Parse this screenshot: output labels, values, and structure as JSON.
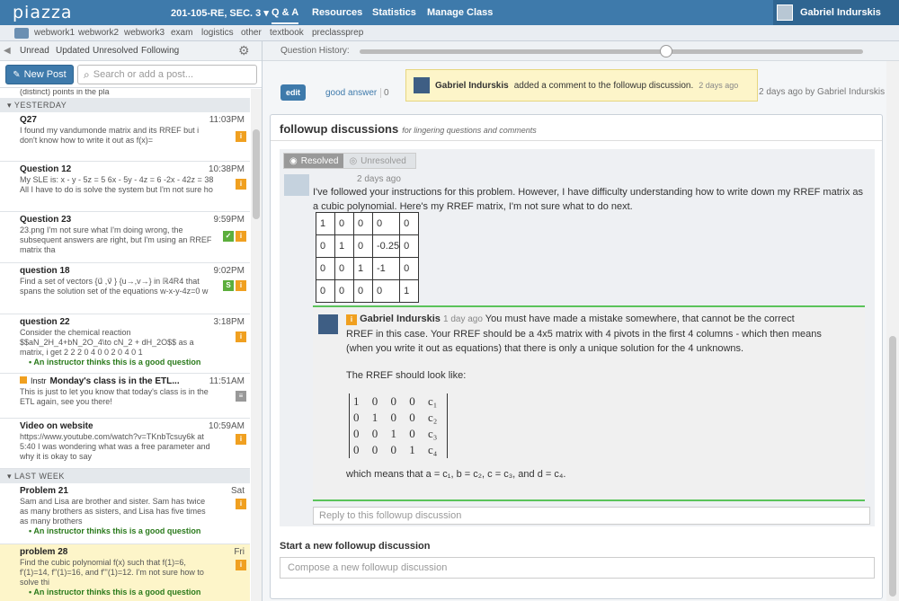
{
  "topbar": {
    "logo": "piazza",
    "course": "201-105-RE, SEC. 3",
    "course_caret": "▾",
    "nav": [
      "Q & A",
      "Resources",
      "Statistics",
      "Manage Class"
    ],
    "user_name": "Gabriel Indurskis"
  },
  "folders": [
    "webwork1",
    "webwork2",
    "webwork3",
    "exam",
    "logistics",
    "other",
    "textbook",
    "preclassprep"
  ],
  "filters": [
    "Unread",
    "Updated",
    "Unresolved",
    "Following"
  ],
  "history_label": "Question History:",
  "new_post": "New Post",
  "search_placeholder": "Search or add a post...",
  "feed": {
    "top_snippet": "(distinct) points in the pla",
    "section_yesterday": "YESTERDAY",
    "section_lastweek": "LAST WEEK",
    "good_label": "An instructor thinks this is a good question",
    "posts": [
      {
        "title": "Q27",
        "time": "11:03PM",
        "body": "I found my vandumonde matrix and its RREF but i don't know how to write it out as f(x)=",
        "badge": "i"
      },
      {
        "title": "Question 12",
        "time": "10:38PM",
        "body": "My SLE is: x - y - 5z = 5 6x - 5y - 4z = 6 -2x - 42z = 38 All I have to do is solve the system but I'm not sure ho",
        "badge": "i"
      },
      {
        "title": "Question 23",
        "time": "9:59PM",
        "body": "23.png I'm not sure what I'm doing wrong, the subsequent answers are right, but I'm using an RREF matrix tha",
        "badge": "i"
      },
      {
        "title": "question 18",
        "time": "9:02PM",
        "body": "Find a set of vectors {u⃗ ,v⃗ } {u→,v→} in ℝ4R4 that spans the solution set of the equations w-x-y-4z=0 w",
        "badge": "S"
      },
      {
        "title": "question 22",
        "time": "3:18PM",
        "body": "Consider the chemical reaction $$aN_2H_4+bN_2O_4\\to cN_2 + dH_2O$$ as a matrix, i get 2 2 2 0 4 0 0 2 0 4 0 1",
        "badge": "i"
      },
      {
        "title": "Monday's class is in the ETL...",
        "prefix": "Instr",
        "time": "11:51AM",
        "body": "This is just to let you know that today's class is in the ETL again, see you there!",
        "badge": "note"
      },
      {
        "title": "Video on website",
        "time": "10:59AM",
        "body": "https://www.youtube.com/watch?v=TKnbTcsuy6k at 5:40 I was wondering what was a free parameter and why it is okay to say",
        "badge": "i"
      },
      {
        "title": "Problem 21",
        "time": "Sat",
        "body": "Sam and Lisa are brother and sister. Sam has twice as many brothers as sisters, and Lisa has five times as many brothers",
        "badge": "i"
      },
      {
        "title": "problem 28",
        "time": "Fri",
        "body": "Find the cubic polynomial f(x) such that f(1)=6, f'(1)=14, f''(1)=16, and f'''(1)=12. I'm not sure how to solve thi",
        "badge": "i"
      }
    ]
  },
  "main": {
    "edit": "edit",
    "good_answer": "good answer",
    "good_count": "0",
    "meta": "2 days ago by Gabriel Indurskis",
    "toast_name": "Gabriel Indurskis",
    "toast_text": "added a comment to the followup discussion.",
    "toast_time": "2 days ago",
    "followup_title": "followup discussions",
    "followup_sub": "for lingering questions and comments",
    "resolved": "Resolved",
    "unresolved": "Unresolved",
    "post_time": "2 days ago",
    "post_text": "I've followed your instructions for this problem. However, I have difficulty understanding how to write down my RREF matrix as a cubic polynomial. Here's my RREF matrix, I'm not sure what to do next.",
    "rref": [
      [
        "1",
        "0",
        "0",
        "0",
        "0"
      ],
      [
        "0",
        "1",
        "0",
        "-0.25",
        "0"
      ],
      [
        "0",
        "0",
        "1",
        "-1",
        "0"
      ],
      [
        "0",
        "0",
        "0",
        "0",
        "1"
      ]
    ],
    "reply_name": "Gabriel Indurskis",
    "reply_time": "1 day ago",
    "reply_p1": "You must have made a mistake somewhere, that cannot be the correct RREF in this case. Your RREF should be a 4x5 matrix with 4 pivots in the first 4 columns - which then means (when you write it out as equations) that there is only a unique solution for the 4 unknowns.",
    "reply_p2": "The RREF should look like:",
    "matrix": [
      [
        "1",
        "0",
        "0",
        "0",
        "c₁"
      ],
      [
        "0",
        "1",
        "0",
        "0",
        "c₂"
      ],
      [
        "0",
        "0",
        "1",
        "0",
        "c₃"
      ],
      [
        "0",
        "0",
        "0",
        "1",
        "c₄"
      ]
    ],
    "reply_p3": "which means that a = c₁, b = c₂, c = c₃, and d = c₄.",
    "reply_placeholder": "Reply to this followup discussion",
    "start_title": "Start a new followup discussion",
    "compose_placeholder": "Compose a new followup discussion"
  },
  "colors": {
    "brand": "#3e7aab",
    "badge_orange": "#f0a020",
    "badge_green": "#5cae3c",
    "good_green": "#2a7a1b"
  }
}
